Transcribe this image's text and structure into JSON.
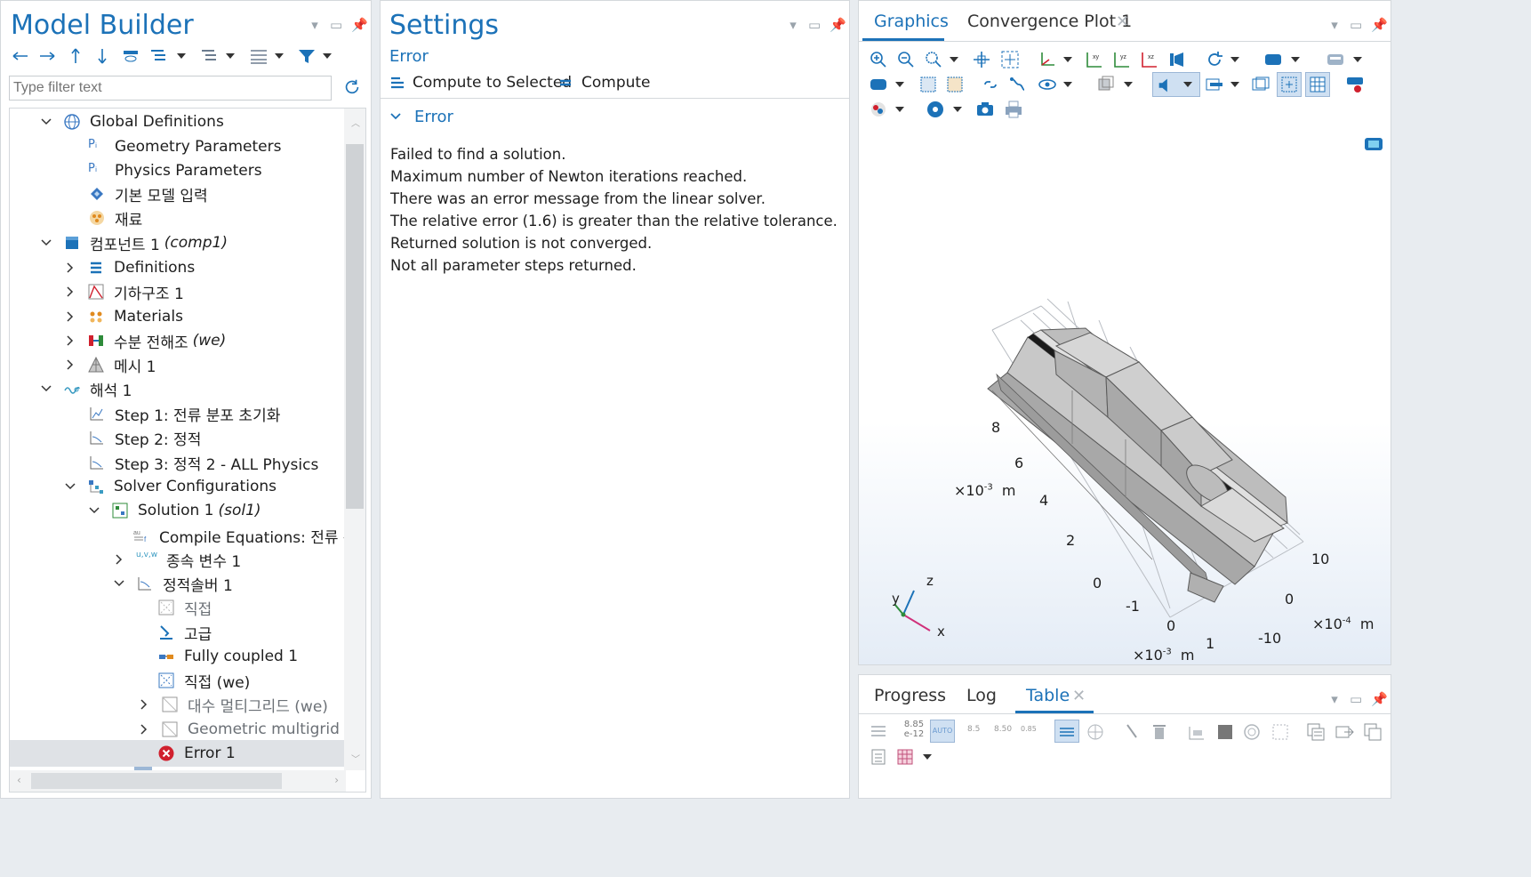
{
  "model_builder": {
    "title": "Model Builder",
    "filter_placeholder": "Type filter text",
    "tree": [
      {
        "label": "Global Definitions",
        "suffix": ""
      },
      {
        "label": "Geometry Parameters",
        "suffix": ""
      },
      {
        "label": "Physics Parameters",
        "suffix": ""
      },
      {
        "label": "기본 모델 입력",
        "suffix": ""
      },
      {
        "label": "재료",
        "suffix": ""
      },
      {
        "label": "컴포넌트 1",
        "suffix": "(comp1)"
      },
      {
        "label": "Definitions",
        "suffix": ""
      },
      {
        "label": "기하구조 1",
        "suffix": ""
      },
      {
        "label": "Materials",
        "suffix": ""
      },
      {
        "label": "수분 전해조",
        "suffix": "(we)"
      },
      {
        "label": "메시 1",
        "suffix": ""
      },
      {
        "label": "해석 1",
        "suffix": ""
      },
      {
        "label": "Step 1: 전류 분포 초기화",
        "suffix": ""
      },
      {
        "label": "Step 2: 정적",
        "suffix": ""
      },
      {
        "label": "Step 3: 정적 2 - ALL Physics",
        "suffix": ""
      },
      {
        "label": "Solver Configurations",
        "suffix": ""
      },
      {
        "label": "Solution 1",
        "suffix": "(sol1)"
      },
      {
        "label": "Compile Equations: 전류 분포",
        "suffix": ""
      },
      {
        "label": "종속 변수 1",
        "suffix": ""
      },
      {
        "label": "정적솔버 1",
        "suffix": ""
      },
      {
        "label": "직접",
        "suffix": ""
      },
      {
        "label": "고급",
        "suffix": ""
      },
      {
        "label": "Fully coupled 1",
        "suffix": ""
      },
      {
        "label": "직접 (we)",
        "suffix": ""
      },
      {
        "label": "대수 멀티그리드 (we)",
        "suffix": ""
      },
      {
        "label": "Geometric multigrid (we)",
        "suffix": ""
      },
      {
        "label": "Error 1",
        "suffix": ""
      }
    ]
  },
  "settings": {
    "title": "Settings",
    "subtitle": "Error",
    "compute_selected_label": "Compute to Selected",
    "compute_label": "Compute",
    "section_label": "Error",
    "messages": [
      "Failed to find a solution.",
      "Maximum number of Newton iterations reached.",
      "There was an error message from the linear solver.",
      "The relative error (1.6) is greater than the relative tolerance.",
      "Returned solution is not converged.",
      "Not all parameter steps returned."
    ]
  },
  "graphics": {
    "tabs": [
      "Graphics",
      "Convergence Plot 1"
    ],
    "axis_z_ticks": [
      "8",
      "6",
      "4",
      "2",
      "0"
    ],
    "axis_z_unit": "×10",
    "axis_z_exp": "-3",
    "axis_z_m": "m",
    "axis_y_ticks": [
      "-1",
      "0",
      "1"
    ],
    "axis_y_unit": "×10",
    "axis_y_exp": "-3",
    "axis_y_m": "m",
    "axis_x_ticks": [
      "10",
      "0",
      "-10"
    ],
    "axis_x_unit": "×10",
    "axis_x_exp": "-4",
    "axis_x_m": "m",
    "triad": {
      "x": "x",
      "y": "y",
      "z": "z"
    }
  },
  "bottom": {
    "tabs": [
      "Progress",
      "Log",
      "Table"
    ],
    "numfmt_top": "8.85",
    "numfmt_bottom": "e-12",
    "auto_label": "AUTO",
    "fmt_a": "8.5",
    "fmt_b": "8.50",
    "fmt_c": "0.85"
  },
  "colors": {
    "accent": "#1c72b8",
    "error": "#d0202e"
  }
}
